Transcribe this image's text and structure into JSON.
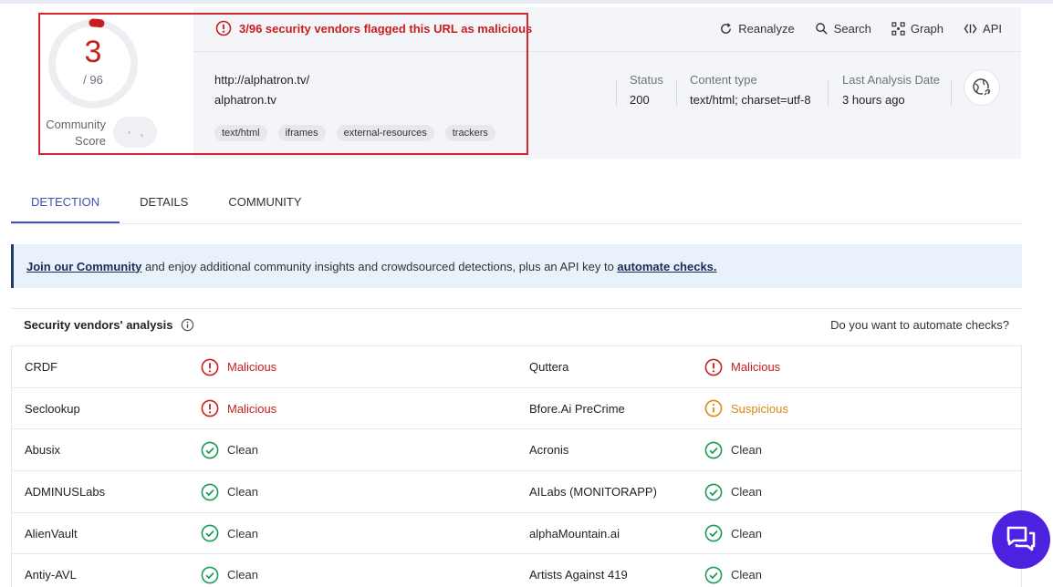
{
  "score": {
    "detections": "3",
    "total": "/ 96",
    "community_label_1": "Community",
    "community_label_2": "Score"
  },
  "alert": {
    "text": "3/96 security vendors flagged this URL as malicious"
  },
  "toolbar": {
    "reanalyze": "Reanalyze",
    "search": "Search",
    "graph": "Graph",
    "api": "API"
  },
  "target": {
    "url": "http://alphatron.tv/",
    "domain": "alphatron.tv"
  },
  "tags": [
    "text/html",
    "iframes",
    "external-resources",
    "trackers"
  ],
  "meta": {
    "status_label": "Status",
    "status_value": "200",
    "content_type_label": "Content type",
    "content_type_value": "text/html; charset=utf-8",
    "last_analysis_label": "Last Analysis Date",
    "last_analysis_value": "3 hours ago"
  },
  "tabs": [
    "DETECTION",
    "DETAILS",
    "COMMUNITY"
  ],
  "banner": {
    "link1": "Join our Community",
    "middle": " and enjoy additional community insights and crowdsourced detections, plus an API key to ",
    "link2": "automate checks."
  },
  "analysis": {
    "title": "Security vendors' analysis",
    "automate_prompt": "Do you want to automate checks?",
    "rows": [
      {
        "v1": "CRDF",
        "r1": "Malicious",
        "s1": "malicious",
        "v2": "Quttera",
        "r2": "Malicious",
        "s2": "malicious"
      },
      {
        "v1": "Seclookup",
        "r1": "Malicious",
        "s1": "malicious",
        "v2": "Bfore.Ai PreCrime",
        "r2": "Suspicious",
        "s2": "suspicious"
      },
      {
        "v1": "Abusix",
        "r1": "Clean",
        "s1": "clean",
        "v2": "Acronis",
        "r2": "Clean",
        "s2": "clean"
      },
      {
        "v1": "ADMINUSLabs",
        "r1": "Clean",
        "s1": "clean",
        "v2": "AILabs (MONITORAPP)",
        "r2": "Clean",
        "s2": "clean"
      },
      {
        "v1": "AlienVault",
        "r1": "Clean",
        "s1": "clean",
        "v2": "alphaMountain.ai",
        "r2": "Clean",
        "s2": "clean"
      },
      {
        "v1": "Antiy-AVL",
        "r1": "Clean",
        "s1": "clean",
        "v2": "Artists Against 419",
        "r2": "Clean",
        "s2": "clean"
      }
    ]
  },
  "colors": {
    "malicious": "#c81e1e",
    "suspicious": "#d88a13",
    "clean": "#1a9a55",
    "accent": "#3f51b5",
    "fab": "#4c22e0"
  },
  "icons": {
    "alert": "alert-circle-icon",
    "reanalyze": "refresh-icon",
    "search": "search-icon",
    "graph": "graph-icon",
    "api": "api-icon",
    "globe": "globe-link-icon",
    "info": "info-icon",
    "chat": "chat-icon"
  }
}
